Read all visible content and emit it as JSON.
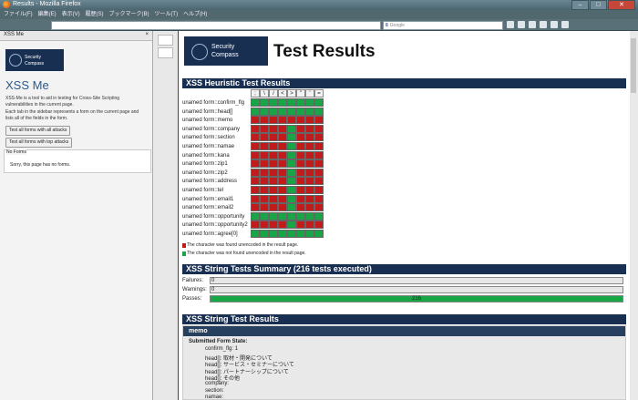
{
  "window": {
    "title": "Results - Mozilla Firefox",
    "min": "–",
    "max": "□",
    "close": "✕"
  },
  "menu": [
    "ファイル(F)",
    "編集(E)",
    "表示(V)",
    "履歴(S)",
    "ブックマーク(B)",
    "ツール(T)",
    "ヘルプ(H)"
  ],
  "search": {
    "placeholder": "Google"
  },
  "sidebar": {
    "header": "XSS Me",
    "close": "×",
    "logo_line1": "Security",
    "logo_line2": "Compass",
    "title": "XSS Me",
    "desc1": "XSS-Me is a tool to aid in testing for Cross-Site Scripting vulnerabilities in the current page.",
    "desc2": "Each tab in the sidebar represents a form on the current page and lists all of the fields in the form.",
    "btn_all": "Test all forms with all attacks",
    "btn_top": "Test all forms with top attacks",
    "forms_label": "No Forms",
    "forms_msg": "Sorry, this page has no forms."
  },
  "page": {
    "logo_line1": "Security",
    "logo_line2": "Compass",
    "title": "Test Results",
    "heuristic_title": "XSS Heuristic Test Results",
    "header_chars": [
      ";",
      "\\",
      "/",
      "<",
      ">",
      "\"",
      "'",
      "="
    ],
    "legend_red": "The character was found unencoded in the result page.",
    "legend_green": "The character was not found unencoded in the result page.",
    "summary_title": "XSS String Tests Summary (216 tests executed)",
    "failures_label": "Failures:",
    "failures": "0",
    "warnings_label": "Warnings:",
    "warnings": "0",
    "passes_label": "Passes:",
    "passes": "216",
    "string_title": "XSS String Test Results",
    "memo_label": "memo",
    "submitted_label": "Submitted Form State:",
    "form_state": [
      "confirm_flg: 1",
      "head[]: 取材・開発について",
      "head[]: サービス・セミナーについて",
      "head[]: パートナーシップについて",
      "head[]: その他",
      "company:",
      "section:",
      "namae:"
    ]
  },
  "heuristic_rows": [
    {
      "label": "unamed form::confirm_flg",
      "cells": "GGGGGGGG"
    },
    {
      "label": "unamed form::head[]",
      "cells": "GGGGGGGG"
    },
    {
      "label": "unamed form::memo",
      "cells": "RRRRRRRR"
    },
    {
      "label": "unamed form::company",
      "cells": "RRRRGRRR"
    },
    {
      "label": "unamed form::section",
      "cells": "RRRRGRRR"
    },
    {
      "label": "unamed form::namae",
      "cells": "RRRRGRRR"
    },
    {
      "label": "unamed form::kana",
      "cells": "RRRRGRRR"
    },
    {
      "label": "unamed form::zip1",
      "cells": "RRRRGRRR"
    },
    {
      "label": "unamed form::zip2",
      "cells": "RRRRGRRR"
    },
    {
      "label": "unamed form::address",
      "cells": "RRRRGRRR"
    },
    {
      "label": "unamed form::tel",
      "cells": "RRRRGRRR"
    },
    {
      "label": "unamed form::email1",
      "cells": "RRRRGRRR"
    },
    {
      "label": "unamed form::email2",
      "cells": "RRRRGRRR"
    },
    {
      "label": "unamed form::opportunity",
      "cells": "GGGGGGGG"
    },
    {
      "label": "unamed form::opportunity2",
      "cells": "RRRRGRRR"
    },
    {
      "label": "unamed form::agree[0]",
      "cells": "GGGGGGGG"
    }
  ]
}
